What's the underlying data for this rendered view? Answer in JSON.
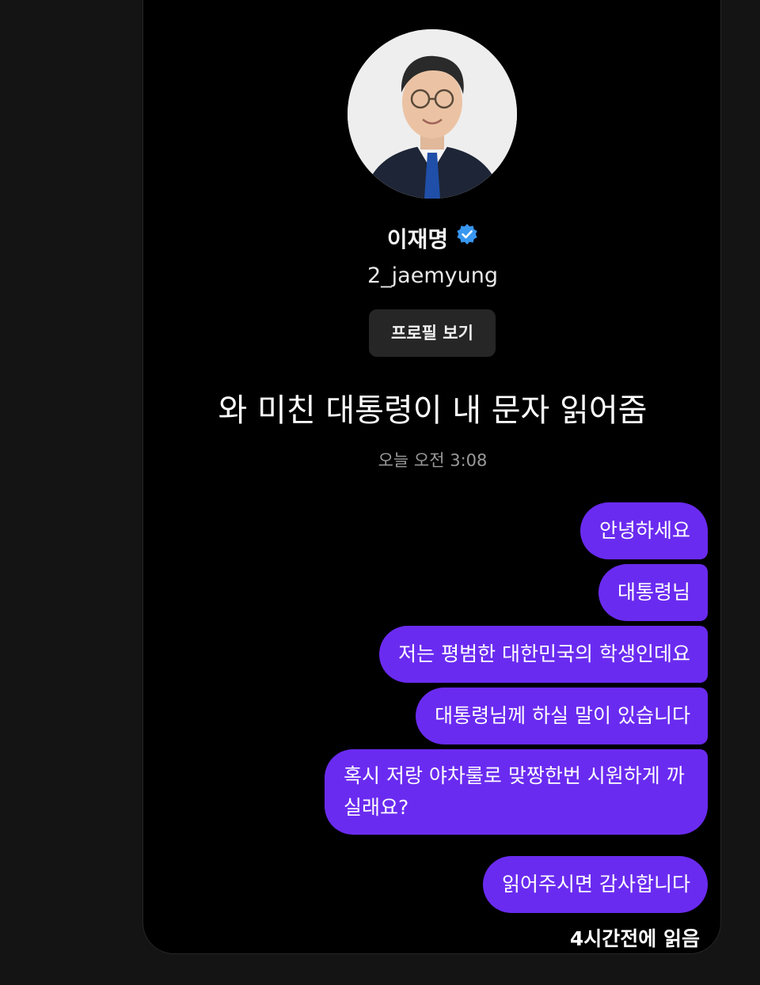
{
  "profile": {
    "name": "이재명",
    "verified_icon": "verified-badge-icon",
    "handle": "2_jaemyung",
    "view_profile_label": "프로필 보기"
  },
  "caption": "와 미친 대통령이 내 문자 읽어줌",
  "timestamp": "오늘 오전 3:08",
  "messages": [
    "안녕하세요",
    "대통령님",
    "저는 평범한 대한민국의 학생인데요",
    "대통령님께 하실 말이 있습니다",
    "혹시 저랑 야차룰로 맞짱한번 시원하게 까실래요?",
    "읽어주시면 감사합니다"
  ],
  "read_receipt": "4시간전에 읽음",
  "colors": {
    "bubble": "#6a2bf0",
    "background": "#000000",
    "outer": "#141414",
    "verified": "#3897f0",
    "button": "#262626"
  }
}
